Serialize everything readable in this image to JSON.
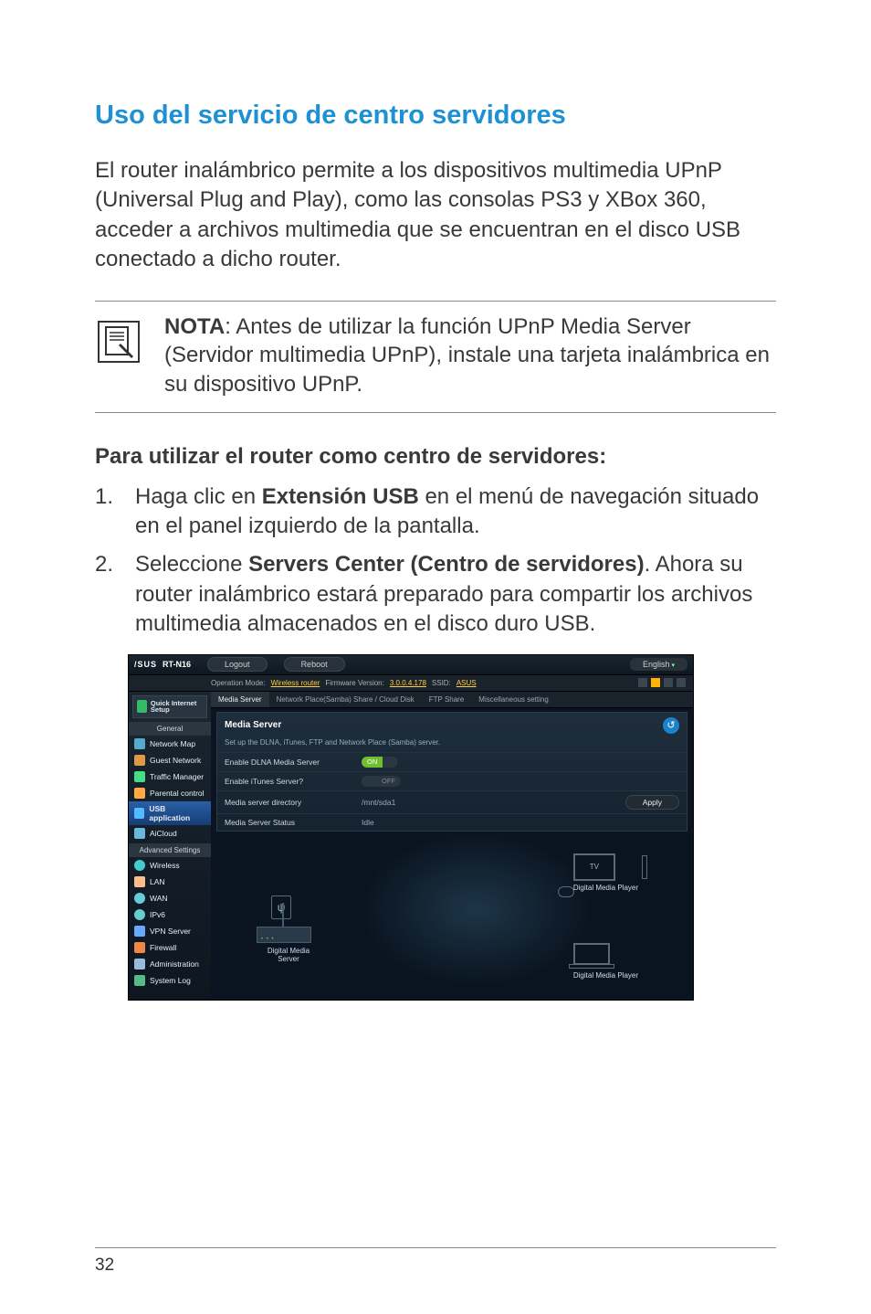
{
  "page": {
    "title": "Uso del servicio de centro servidores",
    "body": "El router inalámbrico permite a los dispositivos multimedia UPnP (Universal Plug and Play), como las consolas PS3 y XBox 360, acceder a archivos multimedia que se encuentran en el disco USB conectado a dicho router.",
    "note_label": "NOTA",
    "note_text": ": Antes de utilizar la función UPnP Media Server (Servidor multimedia UPnP), instale una tarjeta inalámbrica en su dispositivo UPnP.",
    "subheading": "Para utilizar el router como centro de servidores:",
    "steps": [
      {
        "pre": "Haga clic en ",
        "bold": "Extensión USB",
        "post": " en el menú de navegación situado en el panel izquierdo de la pantalla."
      },
      {
        "pre": "Seleccione ",
        "bold": "Servers Center (Centro de servidores)",
        "post": ". Ahora su router inalámbrico estará preparado para compartir los archivos multimedia almacenados en el disco duro USB."
      }
    ],
    "page_number": "32"
  },
  "router": {
    "brand": "/SUS",
    "model": "RT-N16",
    "logout": "Logout",
    "reboot": "Reboot",
    "language": "English",
    "info": {
      "op_mode_label": "Operation Mode:",
      "op_mode_value": "Wireless router",
      "fw_label": "Firmware Version:",
      "fw_value": "3.0.0.4.178",
      "ssid_label": "SSID:",
      "ssid_value": "ASUS"
    },
    "sidebar": {
      "quick_internet": "Quick Internet Setup",
      "general_label": "General",
      "general": [
        {
          "icon": "ic-map",
          "label": "Network Map"
        },
        {
          "icon": "ic-guest",
          "label": "Guest Network"
        },
        {
          "icon": "ic-traffic",
          "label": "Traffic Manager"
        },
        {
          "icon": "ic-parent",
          "label": "Parental control"
        },
        {
          "icon": "ic-usb",
          "label": "USB application"
        },
        {
          "icon": "ic-aicloud",
          "label": "AiCloud"
        }
      ],
      "advanced_label": "Advanced Settings",
      "advanced": [
        {
          "icon": "ic-wifi",
          "label": "Wireless"
        },
        {
          "icon": "ic-lan",
          "label": "LAN"
        },
        {
          "icon": "ic-wan",
          "label": "WAN"
        },
        {
          "icon": "ic-ipv6",
          "label": "IPv6"
        },
        {
          "icon": "ic-vpn",
          "label": "VPN Server"
        },
        {
          "icon": "ic-fw",
          "label": "Firewall"
        },
        {
          "icon": "ic-admin",
          "label": "Administration"
        },
        {
          "icon": "ic-log",
          "label": "System Log"
        }
      ]
    },
    "tabs": [
      "Media Server",
      "Network Place(Samba) Share / Cloud Disk",
      "FTP Share",
      "Miscellaneous setting"
    ],
    "panel": {
      "title": "Media Server",
      "subtitle": "Set up the DLNA, iTunes, FTP and Network Place (Samba) server.",
      "row_dlna": "Enable DLNA Media Server",
      "row_itunes": "Enable iTunes Server?",
      "row_dir": "Media server directory",
      "row_dir_val": "/mnt/sda1",
      "row_status": "Media Server Status",
      "row_status_val": "Idle",
      "on": "ON",
      "off": "OFF",
      "apply": "Apply"
    },
    "diagram": {
      "server_label": "Digital Media Server",
      "tv_label": "TV",
      "player_label_1": "Digital Media Player",
      "player_label_2": "Digital Media Player",
      "usb_glyph": "ψ"
    }
  }
}
